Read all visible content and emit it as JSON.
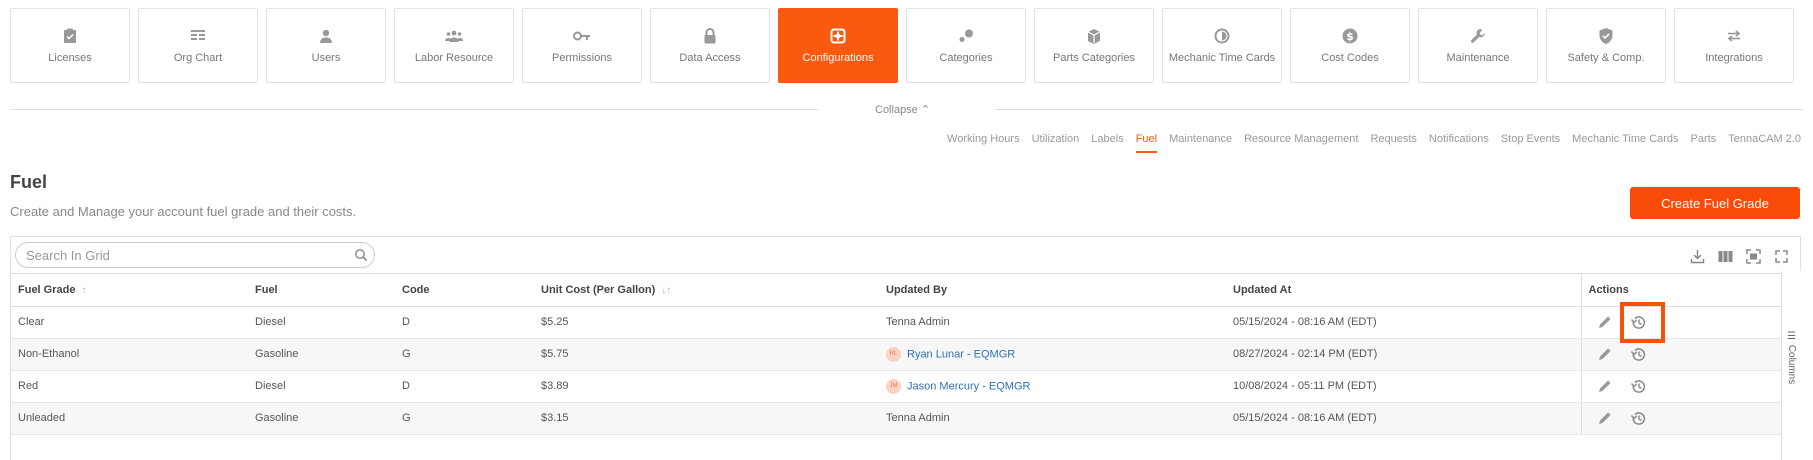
{
  "topnav": [
    {
      "label": "Licenses",
      "icon": "clipboard-check-icon",
      "active": false
    },
    {
      "label": "Org Chart",
      "icon": "org-chart-icon",
      "active": false
    },
    {
      "label": "Users",
      "icon": "user-icon",
      "active": false
    },
    {
      "label": "Labor Resource",
      "icon": "group-icon",
      "active": false
    },
    {
      "label": "Permissions",
      "icon": "key-icon",
      "active": false
    },
    {
      "label": "Data Access",
      "icon": "lock-icon",
      "active": false
    },
    {
      "label": "Configurations",
      "icon": "configurations-icon",
      "active": true
    },
    {
      "label": "Categories",
      "icon": "categories-icon",
      "active": false
    },
    {
      "label": "Parts Categories",
      "icon": "parts-icon",
      "active": false
    },
    {
      "label": "Mechanic Time Cards",
      "icon": "timer-icon",
      "active": false
    },
    {
      "label": "Cost Codes",
      "icon": "dollar-icon",
      "active": false
    },
    {
      "label": "Maintenance",
      "icon": "wrench-icon",
      "active": false
    },
    {
      "label": "Safety & Comp.",
      "icon": "shield-icon",
      "active": false
    },
    {
      "label": "Integrations",
      "icon": "swap-icon",
      "active": false
    }
  ],
  "collapse_label": "Collapse",
  "subtabs": [
    "Working Hours",
    "Utilization",
    "Labels",
    "Fuel",
    "Maintenance",
    "Resource Management",
    "Requests",
    "Notifications",
    "Stop Events",
    "Mechanic Time Cards",
    "Parts",
    "TennaCAM 2.0"
  ],
  "active_subtab": "Fuel",
  "page": {
    "title": "Fuel",
    "subtitle": "Create and Manage your account fuel grade and their costs.",
    "create_button": "Create Fuel Grade"
  },
  "search": {
    "placeholder": "Search In Grid",
    "value": ""
  },
  "columns_tab": "Columns",
  "table": {
    "headers": {
      "fuel_grade": "Fuel Grade",
      "fuel": "Fuel",
      "code": "Code",
      "unit_cost": "Unit Cost (Per Gallon)",
      "updated_by": "Updated By",
      "updated_at": "Updated At",
      "actions": "Actions"
    },
    "rows": [
      {
        "fuel_grade": "Clear",
        "fuel": "Diesel",
        "code": "D",
        "unit_cost": "$5.25",
        "updated_by": "Tenna Admin",
        "initials": "",
        "updated_at": "05/15/2024 - 08:16 AM (EDT)"
      },
      {
        "fuel_grade": "Non-Ethanol",
        "fuel": "Gasoline",
        "code": "G",
        "unit_cost": "$5.75",
        "updated_by": "Ryan Lunar - EQMGR",
        "initials": "RL",
        "updated_at": "08/27/2024 - 02:14 PM (EDT)"
      },
      {
        "fuel_grade": "Red",
        "fuel": "Diesel",
        "code": "D",
        "unit_cost": "$3.89",
        "updated_by": "Jason Mercury - EQMGR",
        "initials": "JM",
        "updated_at": "10/08/2024 - 05:11 PM (EDT)"
      },
      {
        "fuel_grade": "Unleaded",
        "fuel": "Gasoline",
        "code": "G",
        "unit_cost": "$3.15",
        "updated_by": "Tenna Admin",
        "initials": "",
        "updated_at": "05/15/2024 - 08:16 AM (EDT)"
      }
    ]
  },
  "colors": {
    "accent": "#fa5a0f",
    "link": "#2f6fbf",
    "highlight": "#f4520a"
  }
}
